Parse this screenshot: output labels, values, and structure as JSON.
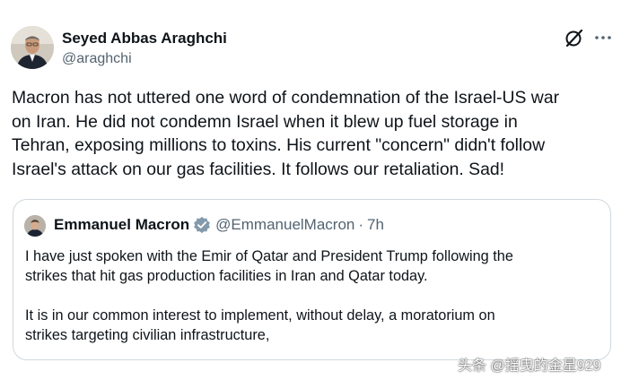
{
  "tweet": {
    "author_name": "Seyed Abbas Araghchi",
    "author_handle": "@araghchi",
    "text_lines": [
      "Macron has not uttered one word of condemnation of the Israel-US war",
      "on Iran. He did not condemn Israel when it blew up fuel storage in",
      "Tehran, exposing millions to toxins. His current \"concern\" didn't follow",
      "Israel's attack on our gas facilities. It follows our retaliation. Sad!"
    ],
    "icons": {
      "grok": "grok-icon",
      "more": "more-options-icon"
    }
  },
  "quoted_tweet": {
    "author_name": "Emmanuel Macron",
    "verified_badge": "verified-badge-icon",
    "author_handle": "@EmmanuelMacron",
    "separator": "·",
    "time": "7h",
    "paragraph1": [
      "I have just spoken with the Emir of Qatar and President Trump following the",
      "strikes that hit gas production facilities in Iran and Qatar today."
    ],
    "paragraph2": [
      "It is in our common interest to implement, without delay, a moratorium on",
      "strikes targeting civilian infrastructure,"
    ]
  },
  "watermark": "头条 @摇曳的金星929",
  "colors": {
    "text": "#0f1419",
    "secondary": "#536471",
    "border": "#cfd9de",
    "verified_gold": "#e2b719"
  }
}
